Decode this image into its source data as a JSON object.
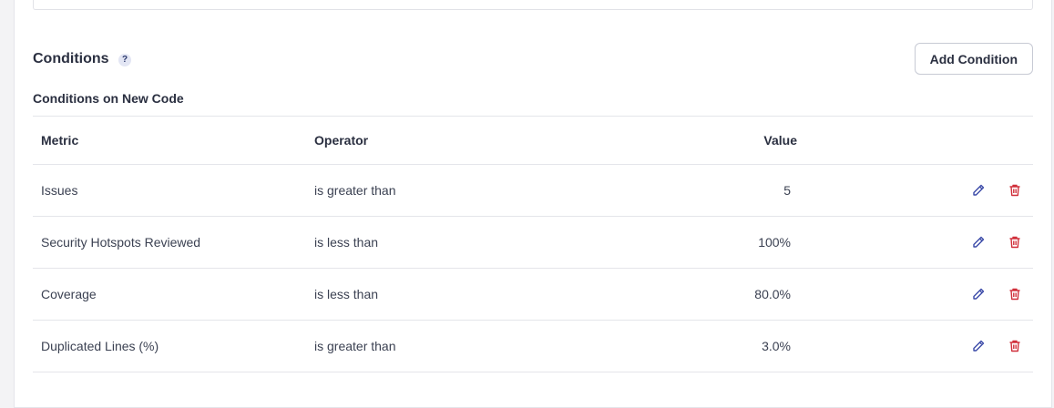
{
  "section": {
    "title": "Conditions",
    "help_icon": "question-icon",
    "add_button_label": "Add Condition",
    "subheading": "Conditions on New Code"
  },
  "table": {
    "headers": {
      "metric": "Metric",
      "operator": "Operator",
      "value": "Value"
    },
    "rows": [
      {
        "metric": "Issues",
        "operator": "is greater than",
        "value": "5"
      },
      {
        "metric": "Security Hotspots Reviewed",
        "operator": "is less than",
        "value": "100%"
      },
      {
        "metric": "Coverage",
        "operator": "is less than",
        "value": "80.0%"
      },
      {
        "metric": "Duplicated Lines (%)",
        "operator": "is greater than",
        "value": "3.0%"
      }
    ],
    "row_actions": {
      "edit_icon": "pencil-icon",
      "delete_icon": "trash-icon"
    }
  },
  "colors": {
    "edit": "#3b4aa8",
    "delete": "#d02f3a",
    "border": "#e4e5ea"
  }
}
